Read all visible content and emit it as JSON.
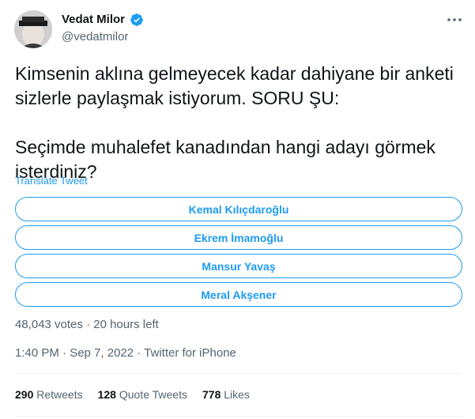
{
  "author": {
    "name": "Vedat Milor",
    "handle": "@vedatmilor",
    "verified_icon": "verified-badge-icon"
  },
  "more_icon": "more-options-icon",
  "tweet": {
    "text": "Kimsenin aklına gelmeyecek kadar dahiyane bir anketi sizlerle paylaşmak istiyorum. SORU ŞU:\n\nSeçimde muhalefet kanadından hangi adayı görmek isterdiniz?",
    "translate_label": "Translate Tweet"
  },
  "poll": {
    "options": [
      "Kemal Kılıçdaroğlu",
      "Ekrem İmamoğlu",
      "Mansur Yavaş",
      "Meral Akşener"
    ],
    "meta": "48,043 votes · 20 hours left"
  },
  "timestamp": "1:40 PM · Sep 7, 2022 · Twitter for iPhone",
  "stats": {
    "retweets_count": "290",
    "retweets_label": "Retweets",
    "quotes_count": "128",
    "quotes_label": "Quote Tweets",
    "likes_count": "778",
    "likes_label": "Likes"
  },
  "colors": {
    "accent": "#1d9bf0",
    "text_primary": "#0f1419",
    "text_secondary": "#536471"
  }
}
